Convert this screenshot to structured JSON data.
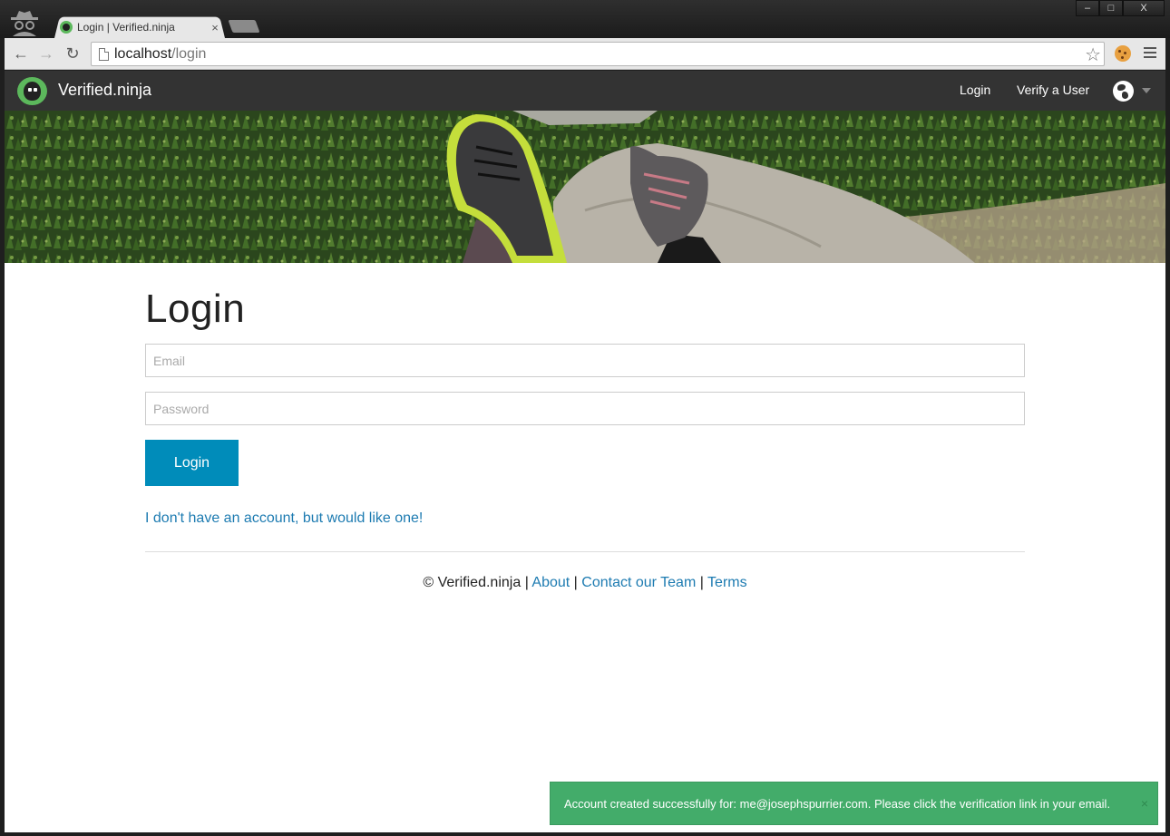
{
  "browser": {
    "tab_title": "Login | Verified.ninja",
    "tab_close": "×",
    "url_host": "localhost",
    "url_path": "/login",
    "window_controls": [
      "–",
      "□",
      "X"
    ]
  },
  "navbar": {
    "brand": "Verified.ninja",
    "links": [
      "Login",
      "Verify a User"
    ],
    "language_icon": "globe-icon"
  },
  "main": {
    "title": "Login",
    "email_placeholder": "Email",
    "password_placeholder": "Password",
    "login_button": "Login",
    "signup_link": "I don't have an account, but would like one!"
  },
  "footer": {
    "copyright": "© Verified.ninja",
    "separator": "|",
    "links": [
      "About",
      "Contact our Team",
      "Terms"
    ]
  },
  "toast": {
    "message": "Account created successfully for: me@josephspurrier.com. Please click the verification link in your email.",
    "close": "×"
  },
  "colors": {
    "navbar_bg": "#333333",
    "primary_button": "#008cba",
    "link": "#1d7bb1",
    "toast_success": "#43ac6a",
    "brand_logo": "#5cb85c"
  }
}
